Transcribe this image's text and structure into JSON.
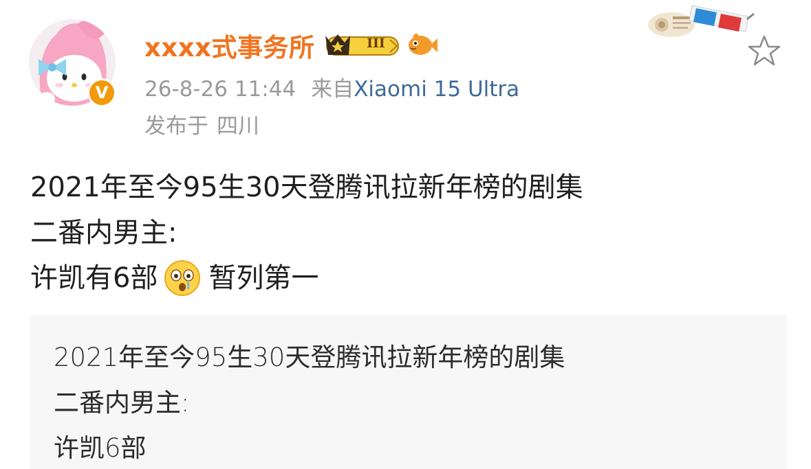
{
  "post": {
    "author": {
      "name": "xxxx式事务所",
      "verified_mark": "V",
      "member_level": "III"
    },
    "meta": {
      "time": "26-8-26 11:44",
      "source_prefix": "来自",
      "device": "Xiaomi 15 Ultra",
      "location_prefix": "发布于",
      "location": "四川"
    },
    "content": {
      "line1": "2021年至今95生30天登腾讯拉新年榜的剧集",
      "line2": "二番内男主:",
      "line3_before_emoji": "许凯有6部",
      "line3_emoji": "shocked-face-emoji",
      "line3_after_emoji": "暂列第一"
    },
    "embedded_image": {
      "line1": "2021年至今95生30天登腾讯拉新年榜的剧集",
      "line2": "二番内男主:",
      "line3": "许凯6部"
    },
    "icons": {
      "star": "star-outline-icon",
      "crown": "crown-level-icon",
      "fish": "fish-icon",
      "glasses": "3d-glasses-icon"
    },
    "colors": {
      "username": "#f0741f",
      "device_link": "#3d6a97",
      "meta_text": "#9a9a9a",
      "body_text": "#1f1f1f",
      "verified_badge": "#f29a0c"
    }
  }
}
